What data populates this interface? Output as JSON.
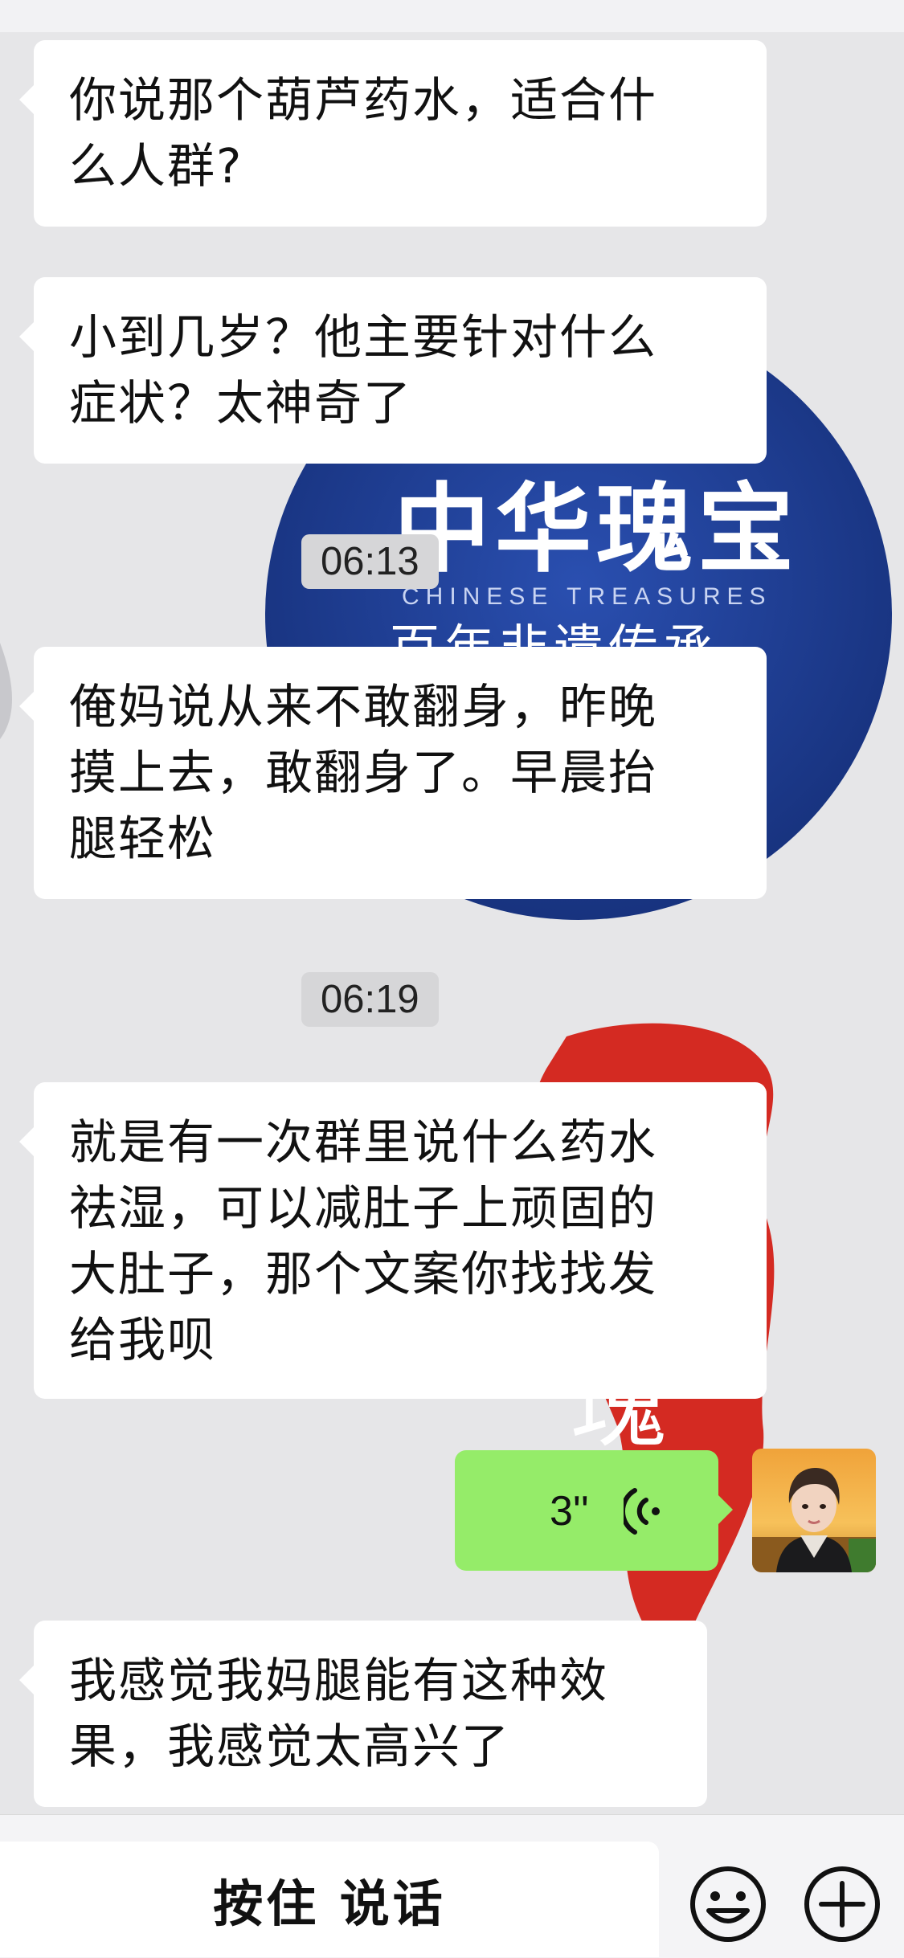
{
  "chat": {
    "messages": [
      {
        "line1": "你说那个葫芦药水，适合什",
        "line2": "么人群?"
      },
      {
        "line1": "小到几岁？他主要针对什么",
        "line2": "症状？太神奇了"
      },
      {
        "line1": "俺妈说从来不敢翻身，昨晚",
        "line2": "摸上去，敢翻身了。早晨抬",
        "line3": "腿轻松"
      },
      {
        "line1": "就是有一次群里说什么药水",
        "line2": "祛湿，可以减肚子上顽固的",
        "line3": "大肚子，那个文案你找找发",
        "line4": "给我呗"
      },
      {
        "line1": "我感觉我妈腿能有这种效",
        "line2": "果，我感觉太高兴了"
      }
    ],
    "timestamps": [
      "06:13",
      "06:19"
    ],
    "voice_message": {
      "duration": "3''"
    }
  },
  "wallpaper": {
    "brand_title": "中华瑰宝",
    "brand_subtitle": "CHINESE TREASURES",
    "brand_tagline": "百年非遗传承",
    "seal_char": "瑰"
  },
  "input_bar": {
    "hold_to_talk_label": "按住 说话",
    "emoji_icon": "emoji-icon",
    "plus_icon": "plus-circle-icon"
  },
  "colors": {
    "background": "#e6e6e8",
    "bubble_in": "#ffffff",
    "bubble_out": "#95ec69",
    "wallpaper_blue": "#1f3f95",
    "wallpaper_red": "#d42a22"
  }
}
